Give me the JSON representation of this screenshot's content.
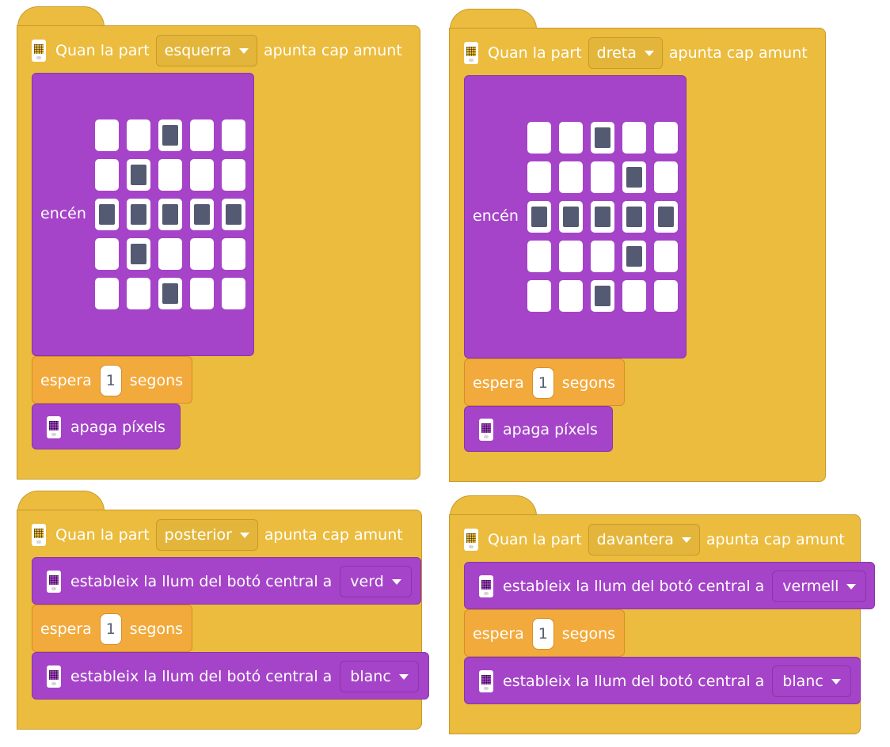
{
  "common": {
    "when_label": "Quan la part",
    "points_up": "apunta cap amunt",
    "light_on": "encén",
    "wait_label": "espera",
    "seconds": "segons",
    "clear_pixels": "apaga píxels",
    "set_center_light": "estableix la llum del botó central a"
  },
  "stacks": [
    {
      "part": "esquerra",
      "matrix": [
        [
          0,
          0,
          1,
          0,
          0
        ],
        [
          0,
          1,
          0,
          0,
          0
        ],
        [
          1,
          1,
          1,
          1,
          1
        ],
        [
          0,
          1,
          0,
          0,
          0
        ],
        [
          0,
          0,
          1,
          0,
          0
        ]
      ],
      "wait": "1"
    },
    {
      "part": "dreta",
      "matrix": [
        [
          0,
          0,
          1,
          0,
          0
        ],
        [
          0,
          0,
          0,
          1,
          0
        ],
        [
          1,
          1,
          1,
          1,
          1
        ],
        [
          0,
          0,
          0,
          1,
          0
        ],
        [
          0,
          0,
          1,
          0,
          0
        ]
      ],
      "wait": "1"
    },
    {
      "part": "posterior",
      "color1": "verd",
      "wait": "1",
      "color2": "blanc"
    },
    {
      "part": "davantera",
      "color1": "vermell",
      "wait": "1",
      "color2": "blanc"
    }
  ],
  "colors": {
    "hat": "#ebbc3d",
    "looks": "#a544c8",
    "control": "#f2aa3c",
    "pixel_on": "#545a72"
  }
}
